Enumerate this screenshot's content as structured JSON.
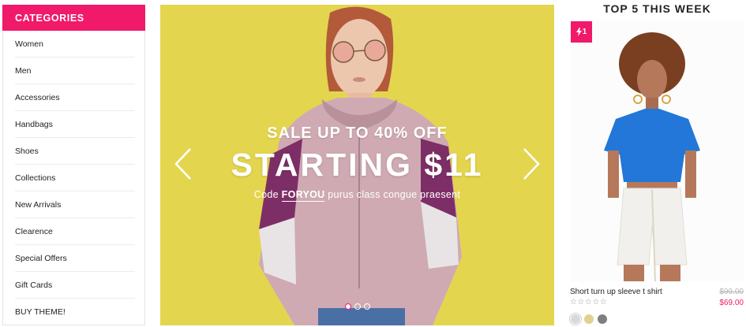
{
  "sidebar": {
    "title": "CATEGORIES",
    "items": [
      {
        "label": "Women"
      },
      {
        "label": "Men"
      },
      {
        "label": "Accessories"
      },
      {
        "label": "Handbags"
      },
      {
        "label": "Shoes"
      },
      {
        "label": "Collections"
      },
      {
        "label": "New Arrivals"
      },
      {
        "label": "Clearence"
      },
      {
        "label": "Special Offers"
      },
      {
        "label": "Gift Cards"
      },
      {
        "label": "BUY THEME!"
      }
    ]
  },
  "hero": {
    "subtitle": "SALE UP TO 40% OFF",
    "title": "STARTING $11",
    "caption_prefix": "Code",
    "code": "FORYOU",
    "caption_suffix": "purus class congue praesent",
    "slides_total": 3,
    "active_slide": 1,
    "prev_icon": "chevron-left-icon",
    "next_icon": "chevron-right-icon"
  },
  "top5": {
    "title": "TOP 5 THIS WEEK",
    "product": {
      "rank": "1",
      "rank_icon": "lightning-icon",
      "name": "Short turn up sleeve t shirt",
      "old_price": "$99.00",
      "price": "$69.00",
      "rating": "☆☆☆☆☆",
      "swatches": [
        "#d9d9d9",
        "#e3d08e",
        "#7f7f7f"
      ]
    }
  },
  "colors": {
    "accent": "#f0196a",
    "hero_bg": "#e4d54f"
  }
}
